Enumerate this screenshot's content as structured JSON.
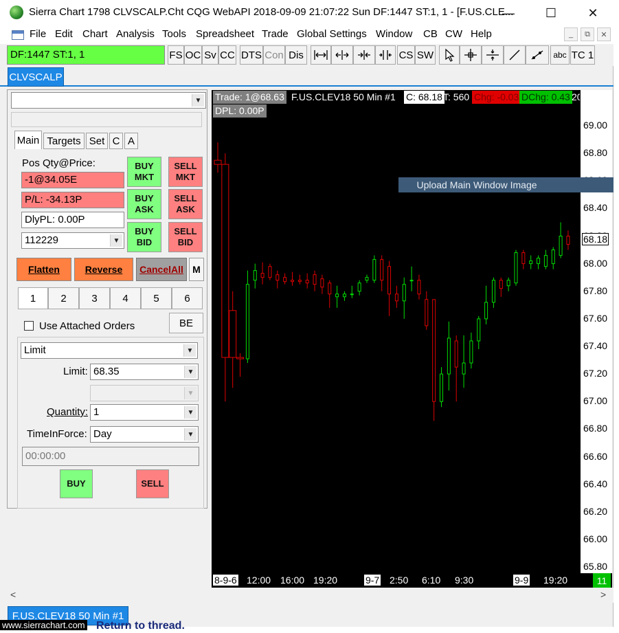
{
  "window": {
    "title": "Sierra Chart 1798 CLVSCALP.Cht  CQG WebAPI 2018-09-09  21:07:22 Sun  DF:1447  ST:1, 1 - [F.US.CLE...",
    "minimize_glyph": "—",
    "maximize_glyph": "☐",
    "close_glyph": "✕"
  },
  "menu": {
    "items": [
      "File",
      "Edit",
      "Chart",
      "Analysis",
      "Tools",
      "Spreadsheet",
      "Trade",
      "Global Settings",
      "Window",
      "CB",
      "CW",
      "Help"
    ],
    "mdi_min": "_",
    "mdi_restore": "⧉",
    "mdi_close": "✕"
  },
  "toolbar": {
    "status": "DF:1447  ST:1, 1",
    "buttons": [
      "FS",
      "OC",
      "Sv",
      "CC",
      "DTS",
      "Con",
      "Dis"
    ],
    "abc_label": "abc",
    "tc_label": "TC 1",
    "colors": {
      "status_bg": "#66ff44"
    }
  },
  "chartbook_tab": {
    "label": "CLVSCALP"
  },
  "trade_window": {
    "tabs": [
      "Main",
      "Targets",
      "Set",
      "C",
      "A"
    ],
    "pos_label": "Pos Qty@Price:",
    "pos_value": "-1@34.05E",
    "pl_value": "P/L: -34.13P",
    "dlypl_value": "DlyPL: 0.00P",
    "account": "112229",
    "buy_mkt": [
      "BUY",
      "MKT"
    ],
    "sell_mkt": [
      "SELL",
      "MKT"
    ],
    "buy_ask": [
      "BUY",
      "ASK"
    ],
    "sell_ask": [
      "SELL",
      "ASK"
    ],
    "buy_bid": [
      "BUY",
      "BID"
    ],
    "sell_bid": [
      "SELL",
      "BID"
    ],
    "flatten": "Flatten",
    "reverse": "Reverse",
    "cancel_all": "CancelAll",
    "m_label": "M",
    "quantity_buttons": [
      "1",
      "2",
      "3",
      "4",
      "5",
      "6"
    ],
    "use_attached_orders": "Use Attached Orders",
    "be_label": "BE",
    "order_type": "Limit",
    "limit_label": "Limit:",
    "limit_value": "68.35",
    "quantity_label": "Quantity:",
    "quantity_value": "1",
    "tif_label": "TimeInForce:",
    "tif_value": "Day",
    "time_value": "00:00:00",
    "buy_label": "BUY",
    "sell_label": "SELL"
  },
  "chart_header": {
    "trade": "Trade: 1@68.63",
    "symbol": "F.US.CLEV18  50 Min   #1",
    "close": "C: 68.18",
    "ticks": "T: 560",
    "chg": "Chg: -0.03",
    "dchg": "DChg: 0.43",
    "more": "20",
    "dpl": "DPL: 0.00P"
  },
  "upload_banner": "Upload Main Window Image",
  "bottom_tab": {
    "label": "F.US.CLEV18  50 Min   #1"
  },
  "footer": {
    "url": "www.sierrachart.com",
    "behind_text": "Return to thread."
  },
  "chart_data": {
    "type": "candlestick",
    "symbol": "F.US.CLEV18",
    "timeframe": "50 Min",
    "ylim": [
      65.8,
      69.0
    ],
    "y_ticks": [
      "69.00",
      "68.80",
      "68.60",
      "68.40",
      "68.20",
      "68.00",
      "67.80",
      "67.60",
      "67.40",
      "67.20",
      "67.00",
      "66.80",
      "66.60",
      "66.40",
      "66.20",
      "66.00",
      "65.80"
    ],
    "last_price_label": "68.18",
    "x_tick_labels": [
      "8-9-6",
      "12:00",
      "16:00",
      "19:20",
      "9-7",
      "2:50",
      "6:10",
      "9:30",
      "9-9",
      "19:20"
    ],
    "x_counter": "11",
    "colors": {
      "up": "#00e000",
      "down": "#e00000",
      "background": "#000000"
    },
    "candles": [
      {
        "o": 68.75,
        "h": 68.88,
        "l": 68.66,
        "c": 68.72
      },
      {
        "o": 68.72,
        "h": 68.8,
        "l": 67.0,
        "c": 67.32
      },
      {
        "o": 67.66,
        "h": 67.8,
        "l": 67.1,
        "c": 67.32
      },
      {
        "o": 67.32,
        "h": 67.35,
        "l": 67.18,
        "c": 67.31
      },
      {
        "o": 67.31,
        "h": 67.95,
        "l": 67.28,
        "c": 67.85
      },
      {
        "o": 67.88,
        "h": 68.0,
        "l": 67.82,
        "c": 67.95
      },
      {
        "o": 67.93,
        "h": 68.01,
        "l": 67.85,
        "c": 67.9
      },
      {
        "o": 67.98,
        "h": 68.0,
        "l": 67.88,
        "c": 67.9
      },
      {
        "o": 67.92,
        "h": 67.95,
        "l": 67.82,
        "c": 67.88
      },
      {
        "o": 67.9,
        "h": 67.93,
        "l": 67.85,
        "c": 67.87
      },
      {
        "o": 67.88,
        "h": 67.94,
        "l": 67.84,
        "c": 67.87
      },
      {
        "o": 67.88,
        "h": 67.92,
        "l": 67.85,
        "c": 67.87
      },
      {
        "o": 67.88,
        "h": 67.93,
        "l": 67.82,
        "c": 67.86
      },
      {
        "o": 67.92,
        "h": 67.95,
        "l": 67.8,
        "c": 67.85
      },
      {
        "o": 67.89,
        "h": 67.92,
        "l": 67.78,
        "c": 67.83
      },
      {
        "o": 67.86,
        "h": 67.88,
        "l": 67.68,
        "c": 67.78
      },
      {
        "o": 67.76,
        "h": 67.84,
        "l": 67.68,
        "c": 67.78
      },
      {
        "o": 67.76,
        "h": 67.8,
        "l": 67.73,
        "c": 67.78
      },
      {
        "o": 67.78,
        "h": 67.84,
        "l": 67.75,
        "c": 67.78
      },
      {
        "o": 67.8,
        "h": 67.88,
        "l": 67.77,
        "c": 67.86
      },
      {
        "o": 67.88,
        "h": 67.92,
        "l": 67.86,
        "c": 67.9
      },
      {
        "o": 67.88,
        "h": 68.06,
        "l": 67.86,
        "c": 68.03
      },
      {
        "o": 68.03,
        "h": 68.06,
        "l": 67.8,
        "c": 67.88
      },
      {
        "o": 67.98,
        "h": 68.02,
        "l": 67.62,
        "c": 67.78
      },
      {
        "o": 67.78,
        "h": 67.84,
        "l": 67.68,
        "c": 67.73
      },
      {
        "o": 67.73,
        "h": 67.9,
        "l": 67.6,
        "c": 67.85
      },
      {
        "o": 67.88,
        "h": 67.98,
        "l": 67.8,
        "c": 67.88
      },
      {
        "o": 67.88,
        "h": 67.92,
        "l": 67.74,
        "c": 67.78
      },
      {
        "o": 67.74,
        "h": 67.8,
        "l": 67.52,
        "c": 67.55
      },
      {
        "o": 67.74,
        "h": 67.74,
        "l": 66.86,
        "c": 67.0
      },
      {
        "o": 67.0,
        "h": 67.25,
        "l": 66.96,
        "c": 67.2
      },
      {
        "o": 67.2,
        "h": 67.58,
        "l": 67.08,
        "c": 67.46
      },
      {
        "o": 67.44,
        "h": 67.48,
        "l": 67.0,
        "c": 67.25
      },
      {
        "o": 67.2,
        "h": 67.48,
        "l": 67.1,
        "c": 67.28
      },
      {
        "o": 67.28,
        "h": 67.5,
        "l": 67.24,
        "c": 67.44
      },
      {
        "o": 67.44,
        "h": 67.62,
        "l": 67.38,
        "c": 67.6
      },
      {
        "o": 67.6,
        "h": 67.84,
        "l": 67.56,
        "c": 67.72
      },
      {
        "o": 67.72,
        "h": 67.9,
        "l": 67.68,
        "c": 67.88
      },
      {
        "o": 67.88,
        "h": 67.9,
        "l": 67.76,
        "c": 67.82
      },
      {
        "o": 67.84,
        "h": 67.9,
        "l": 67.8,
        "c": 67.88
      },
      {
        "o": 67.86,
        "h": 68.1,
        "l": 67.84,
        "c": 68.08
      },
      {
        "o": 68.08,
        "h": 68.1,
        "l": 67.96,
        "c": 68.0
      },
      {
        "o": 68.0,
        "h": 68.06,
        "l": 67.96,
        "c": 68.02
      },
      {
        "o": 68.0,
        "h": 68.06,
        "l": 67.96,
        "c": 68.04
      },
      {
        "o": 67.98,
        "h": 68.1,
        "l": 67.96,
        "c": 68.06
      },
      {
        "o": 68.0,
        "h": 68.12,
        "l": 67.96,
        "c": 68.1
      },
      {
        "o": 68.06,
        "h": 68.3,
        "l": 68.04,
        "c": 68.2
      },
      {
        "o": 68.2,
        "h": 68.24,
        "l": 68.1,
        "c": 68.14
      }
    ]
  }
}
